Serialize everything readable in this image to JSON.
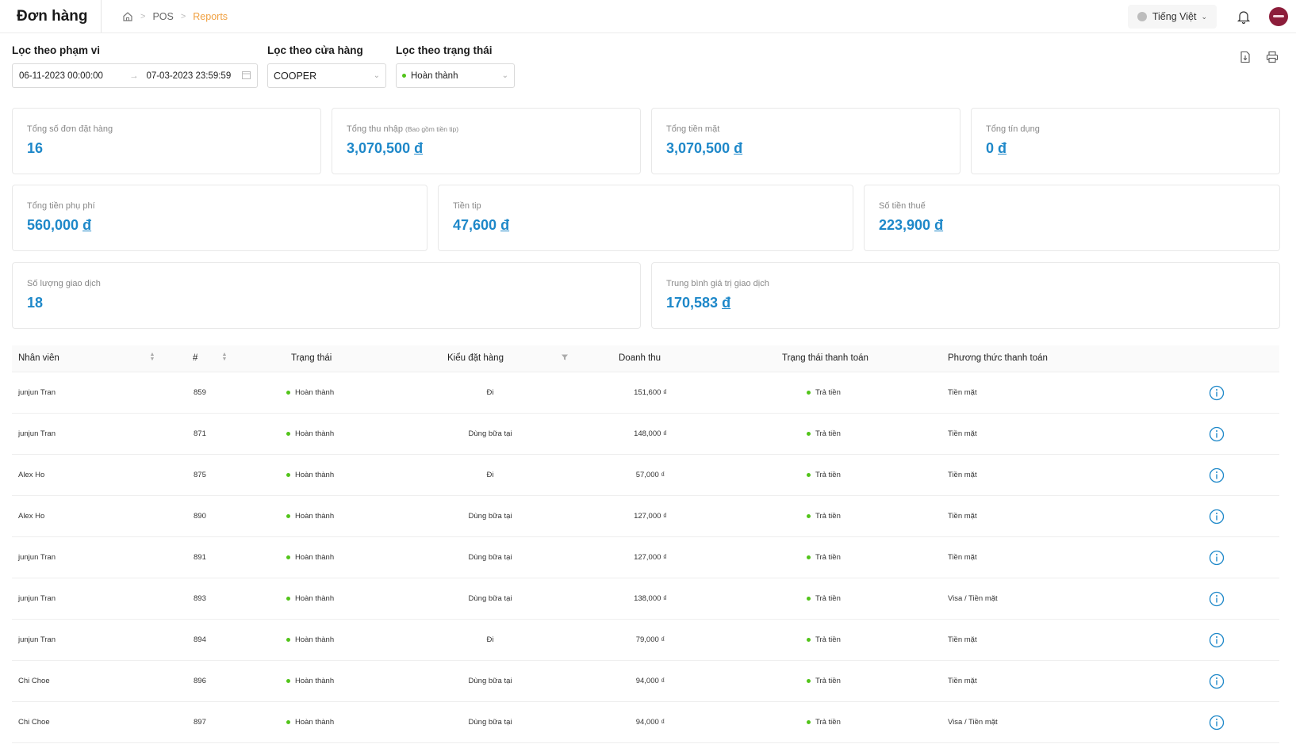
{
  "header": {
    "title": "Đơn hàng",
    "breadcrumb": [
      "POS",
      "Reports"
    ],
    "language": "Tiếng Việt"
  },
  "filters": {
    "range_label": "Lọc theo phạm vi",
    "date_from": "06-11-2023 00:00:00",
    "date_to": "07-03-2023 23:59:59",
    "store_label": "Lọc theo cửa hàng",
    "store_value": "COOPER",
    "status_label": "Lọc theo trạng thái",
    "status_value": "Hoàn thành"
  },
  "stats": {
    "total_orders": {
      "label": "Tổng số đơn đặt hàng",
      "value": "16"
    },
    "total_income": {
      "label": "Tổng thu nhập",
      "sub": "(Bao gồm tiền tip)",
      "value": "3,070,500",
      "currency": "đ"
    },
    "total_cash": {
      "label": "Tổng tiền mặt",
      "value": "3,070,500",
      "currency": "đ"
    },
    "total_credit": {
      "label": "Tổng tín dụng",
      "value": "0",
      "currency": "đ"
    },
    "total_surcharge": {
      "label": "Tổng tiền phụ phí",
      "value": "560,000",
      "currency": "đ"
    },
    "tip": {
      "label": "Tiền tip",
      "value": "47,600",
      "currency": "đ"
    },
    "tax": {
      "label": "Số tiền thuế",
      "value": "223,900",
      "currency": "đ"
    },
    "transactions": {
      "label": "Số lượng giao dịch",
      "value": "18"
    },
    "avg_transaction": {
      "label": "Trung bình giá trị giao dịch",
      "value": "170,583",
      "currency": "đ"
    }
  },
  "table": {
    "columns": {
      "employee": "Nhân viên",
      "number": "#",
      "status": "Trạng thái",
      "order_type": "Kiểu đặt hàng",
      "revenue": "Doanh thu",
      "payment_status": "Trạng thái thanh toán",
      "payment_method": "Phương thức thanh toán"
    },
    "rows": [
      {
        "employee": "junjun Tran",
        "number": "859",
        "status": "Hoàn thành",
        "order_type": "Đi",
        "revenue": "151,600 ₫",
        "payment_status": "Trả tiền",
        "payment_method": "Tiền mặt"
      },
      {
        "employee": "junjun Tran",
        "number": "871",
        "status": "Hoàn thành",
        "order_type": "Dùng bữa tại",
        "revenue": "148,000 ₫",
        "payment_status": "Trả tiền",
        "payment_method": "Tiền mặt"
      },
      {
        "employee": "Alex Ho",
        "number": "875",
        "status": "Hoàn thành",
        "order_type": "Đi",
        "revenue": "57,000 ₫",
        "payment_status": "Trả tiền",
        "payment_method": "Tiền mặt"
      },
      {
        "employee": "Alex Ho",
        "number": "890",
        "status": "Hoàn thành",
        "order_type": "Dùng bữa tại",
        "revenue": "127,000 ₫",
        "payment_status": "Trả tiền",
        "payment_method": "Tiền mặt"
      },
      {
        "employee": "junjun Tran",
        "number": "891",
        "status": "Hoàn thành",
        "order_type": "Dùng bữa tại",
        "revenue": "127,000 ₫",
        "payment_status": "Trả tiền",
        "payment_method": "Tiền mặt"
      },
      {
        "employee": "junjun Tran",
        "number": "893",
        "status": "Hoàn thành",
        "order_type": "Dùng bữa tại",
        "revenue": "138,000 ₫",
        "payment_status": "Trả tiền",
        "payment_method": "Visa / Tiền mặt"
      },
      {
        "employee": "junjun Tran",
        "number": "894",
        "status": "Hoàn thành",
        "order_type": "Đi",
        "revenue": "79,000 ₫",
        "payment_status": "Trả tiền",
        "payment_method": "Tiền mặt"
      },
      {
        "employee": "Chi Choe",
        "number": "896",
        "status": "Hoàn thành",
        "order_type": "Dùng bữa tại",
        "revenue": "94,000 ₫",
        "payment_status": "Trả tiền",
        "payment_method": "Tiền mặt"
      },
      {
        "employee": "Chi Choe",
        "number": "897",
        "status": "Hoàn thành",
        "order_type": "Dùng bữa tại",
        "revenue": "94,000 ₫",
        "payment_status": "Trả tiền",
        "payment_method": "Visa / Tiền mặt"
      }
    ]
  },
  "colors": {
    "accent": "#1e88c9",
    "breadcrumb_active": "#f0a040",
    "status_green": "#52c41a"
  }
}
